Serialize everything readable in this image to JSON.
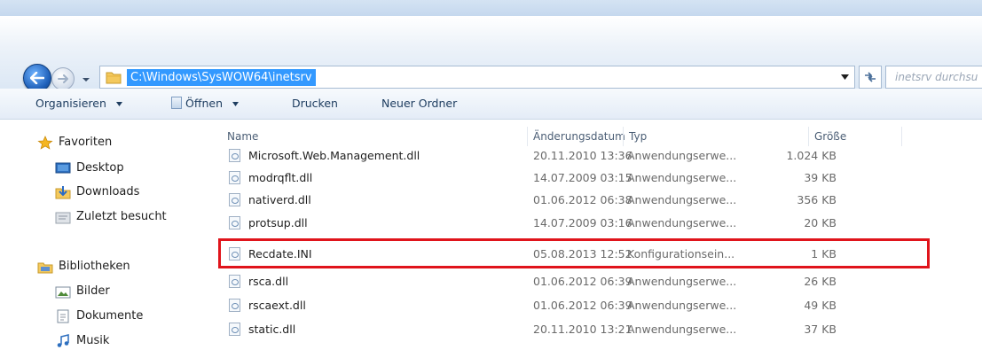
{
  "address": {
    "path": "C:\\Windows\\SysWOW64\\inetsrv",
    "search_placeholder": "inetsrv durchsu"
  },
  "toolbar": {
    "organize": "Organisieren",
    "open": "Öffnen",
    "print": "Drucken",
    "new_folder": "Neuer Ordner"
  },
  "sidebar": {
    "favorites": "Favoriten",
    "desktop": "Desktop",
    "downloads": "Downloads",
    "recent": "Zuletzt besucht",
    "libraries": "Bibliotheken",
    "pictures": "Bilder",
    "documents": "Dokumente",
    "music": "Musik"
  },
  "columns": {
    "name": "Name",
    "date": "Änderungsdatum",
    "type": "Typ",
    "size": "Größe"
  },
  "files": [
    {
      "name": "Microsoft.Web.Management.dll",
      "date": "20.11.2010 13:36",
      "type": "Anwendungserwe...",
      "size": "1.024 KB"
    },
    {
      "name": "modrqflt.dll",
      "date": "14.07.2009 03:15",
      "type": "Anwendungserwe...",
      "size": "39 KB"
    },
    {
      "name": "nativerd.dll",
      "date": "01.06.2012 06:38",
      "type": "Anwendungserwe...",
      "size": "356 KB"
    },
    {
      "name": "protsup.dll",
      "date": "14.07.2009 03:16",
      "type": "Anwendungserwe...",
      "size": "20 KB"
    },
    {
      "name": "Recdate.INI",
      "date": "05.08.2013 12:52",
      "type": "Konfigurationsein...",
      "size": "1 KB"
    },
    {
      "name": "rsca.dll",
      "date": "01.06.2012 06:39",
      "type": "Anwendungserwe...",
      "size": "26 KB"
    },
    {
      "name": "rscaext.dll",
      "date": "01.06.2012 06:39",
      "type": "Anwendungserwe...",
      "size": "49 KB"
    },
    {
      "name": "static.dll",
      "date": "20.11.2010 13:21",
      "type": "Anwendungserwe...",
      "size": "37 KB"
    }
  ],
  "colors": {
    "selection": "#3399ff",
    "highlight_box": "#e0141b",
    "toolbar_text": "#1e3d60"
  }
}
